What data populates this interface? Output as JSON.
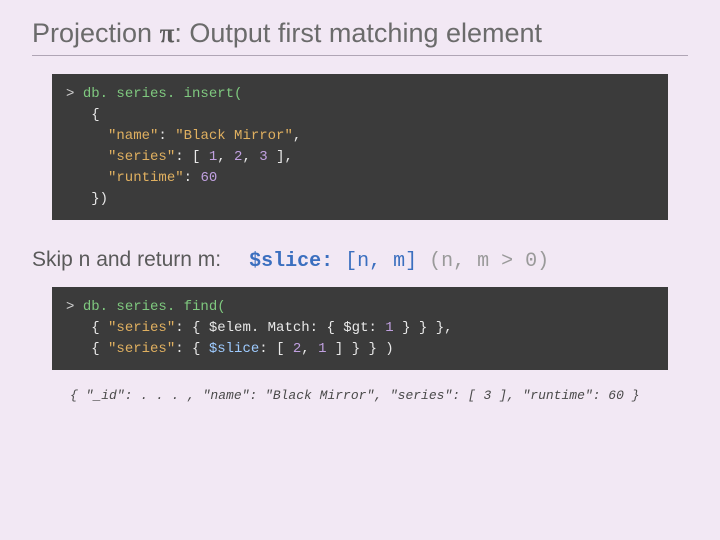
{
  "title": {
    "prefix": "Projection ",
    "symbol": "π",
    "suffix": ": Output first matching element"
  },
  "code1": {
    "l1_prompt": "> ",
    "l1": "db. series. insert(",
    "l2": "   {",
    "l3a": "     \"name\"",
    "l3b": ": ",
    "l3c": "\"Black Mirror\"",
    "l3d": ",",
    "l4a": "     \"series\"",
    "l4b": ": [ ",
    "l4n1": "1",
    "l4s1": ", ",
    "l4n2": "2",
    "l4s2": ", ",
    "l4n3": "3",
    "l4c": " ],",
    "l5a": "     \"runtime\"",
    "l5b": ": ",
    "l5n": "60",
    "l6": "   })"
  },
  "subtitle": {
    "text": "Skip n and return m:",
    "slice": "$slice:",
    "args": " [n, m]",
    "cond": " (n, m > 0)"
  },
  "code2": {
    "l1_prompt": "> ",
    "l1": "db. series. find(",
    "l2a": "   { ",
    "l2b": "\"series\"",
    "l2c": ": { $elem. Match: { $gt: ",
    "l2n": "1",
    "l2d": " } } },",
    "l3a": "   { ",
    "l3b": "\"series\"",
    "l3c": ": { ",
    "l3slice": "$slice",
    "l3d": ": [ ",
    "l3n1": "2",
    "l3s1": ", ",
    "l3n2": "1",
    "l3e": " ] } } )"
  },
  "result": "{ \"_id\": . . . , \"name\": \"Black Mirror\", \"series\": [ 3 ], \"runtime\": 60 }"
}
